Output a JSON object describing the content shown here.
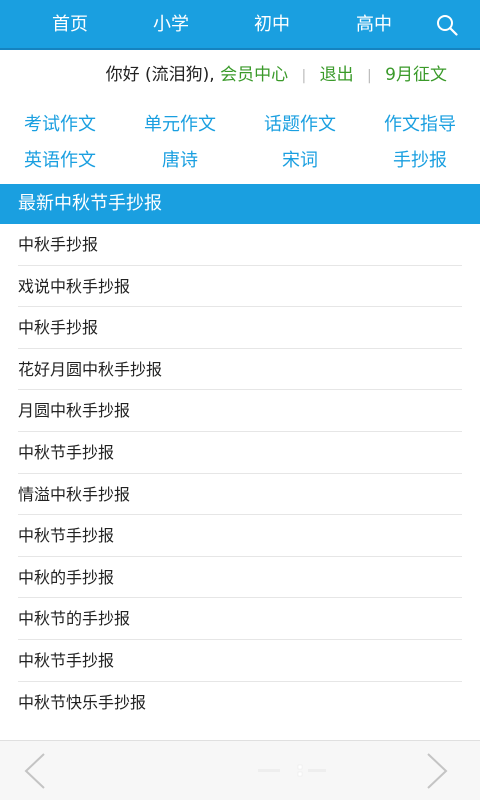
{
  "nav": {
    "items": [
      "首页",
      "小学",
      "初中",
      "高中"
    ]
  },
  "greeting": {
    "hello": "你好 (流泪狗),",
    "member_center": "会员中心",
    "logout": "退出",
    "contest": "9月征文"
  },
  "categories": [
    "考试作文",
    "单元作文",
    "话题作文",
    "作文指导",
    "英语作文",
    "唐诗",
    "宋词",
    "手抄报"
  ],
  "section": {
    "title": "最新中秋节手抄报"
  },
  "articles": [
    "中秋手抄报",
    "戏说中秋手抄报",
    "中秋手抄报",
    "花好月圆中秋手抄报",
    "月圆中秋手抄报",
    "中秋节手抄报",
    "情溢中秋手抄报",
    "中秋节手抄报",
    "中秋的手抄报",
    "中秋节的手抄报",
    "中秋节手抄报",
    "中秋节快乐手抄报"
  ],
  "colors": {
    "brand": "#1a9fe0",
    "green": "#3a9a2a"
  },
  "icons": {
    "search": "search-icon",
    "prev": "chevron-left-icon",
    "next": "chevron-right-icon"
  }
}
